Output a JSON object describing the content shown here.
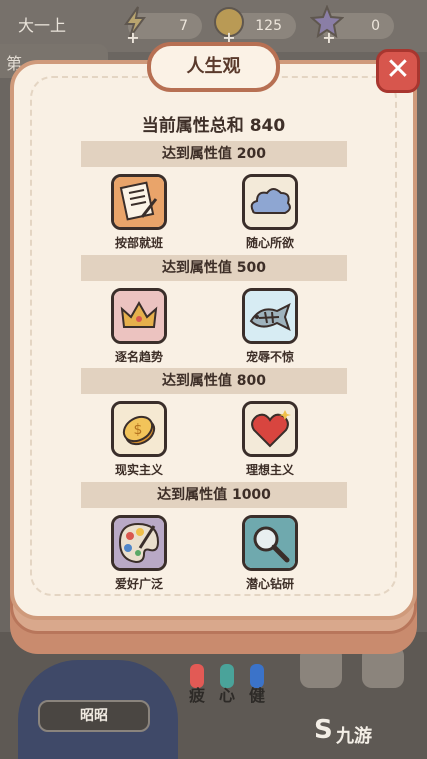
{
  "top_bar": {
    "season": "大一上",
    "energy": "7",
    "coins": "125",
    "stars": "0",
    "add_symbol": "+"
  },
  "background": {
    "tab_label": "第",
    "name": "昭昭",
    "vitals": [
      "疲",
      "心",
      "健"
    ],
    "vital_colors": [
      "#e25a55",
      "#4aa39a",
      "#3b73c9"
    ]
  },
  "modal": {
    "title": "人生观",
    "close_symbol": "✕",
    "total_label": "当前属性总和 840",
    "tiers": [
      {
        "label": "达到属性值 200",
        "items": [
          {
            "name": "按部就班",
            "icon": "checklist-icon"
          },
          {
            "name": "随心所欲",
            "icon": "cloud-icon"
          }
        ]
      },
      {
        "label": "达到属性值 500",
        "items": [
          {
            "name": "逐名趋势",
            "icon": "crown-icon"
          },
          {
            "name": "宠辱不惊",
            "icon": "fish-bone-icon"
          }
        ]
      },
      {
        "label": "达到属性值 800",
        "items": [
          {
            "name": "现实主义",
            "icon": "coin-icon"
          },
          {
            "name": "理想主义",
            "icon": "heart-icon"
          }
        ]
      },
      {
        "label": "达到属性值 1000",
        "items": [
          {
            "name": "爱好广泛",
            "icon": "palette-icon"
          },
          {
            "name": "潜心钻研",
            "icon": "magnifier-icon"
          }
        ]
      }
    ]
  },
  "watermark": {
    "text": "九游",
    "mark": "S"
  },
  "colors": {
    "accent_border": "#cf9a7b",
    "close_red": "#d7564d",
    "panel_bg": "#f9f0e4",
    "tier_bg": "#e2d2c0"
  }
}
